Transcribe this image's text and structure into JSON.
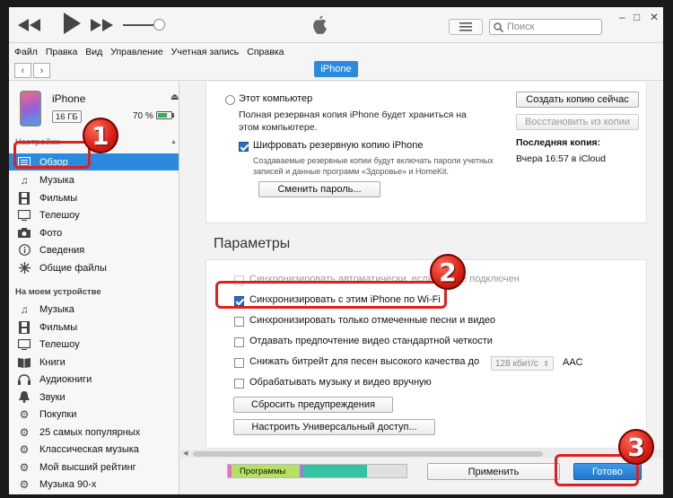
{
  "app": {
    "colors": {
      "accent": "#2a8bde",
      "callout": "#e02020",
      "battery": "#2fb34a"
    }
  },
  "player": {
    "icons": [
      "rewind-icon",
      "play-icon",
      "fast-forward-icon",
      "apple-logo-icon",
      "list-view-icon",
      "search-icon"
    ],
    "search_placeholder": "Поиск",
    "window_controls": [
      "–",
      "□",
      "✕"
    ]
  },
  "menu": [
    "Файл",
    "Правка",
    "Вид",
    "Управление",
    "Учетная запись",
    "Справка"
  ],
  "nav": {
    "device_tab": "iPhone"
  },
  "device": {
    "name": "iPhone",
    "capacity": "16 ГБ",
    "battery": "70 %",
    "battery_level": 0.7
  },
  "sidebar": {
    "settings_label": "Настройки",
    "settings_items": [
      {
        "label": "Обзор",
        "icon": "summary-icon"
      },
      {
        "label": "Музыка",
        "icon": "music-note-icon"
      },
      {
        "label": "Фильмы",
        "icon": "film-icon"
      },
      {
        "label": "Телешоу",
        "icon": "tv-icon"
      },
      {
        "label": "Фото",
        "icon": "camera-icon"
      },
      {
        "label": "Сведения",
        "icon": "info-icon"
      },
      {
        "label": "Общие файлы",
        "icon": "apps-icon"
      }
    ],
    "on_device_label": "На моем устройстве",
    "device_items": [
      {
        "label": "Музыка",
        "icon": "music-note-icon"
      },
      {
        "label": "Фильмы",
        "icon": "film-icon"
      },
      {
        "label": "Телешоу",
        "icon": "tv-icon"
      },
      {
        "label": "Книги",
        "icon": "book-icon"
      },
      {
        "label": "Аудиокниги",
        "icon": "audiobook-icon"
      },
      {
        "label": "Звуки",
        "icon": "bell-icon"
      },
      {
        "label": "Покупки",
        "icon": "purchases-icon"
      },
      {
        "label": "25 самых популярных",
        "icon": "gear-icon"
      },
      {
        "label": "Классическая музыка",
        "icon": "gear-icon"
      },
      {
        "label": "Мой высший рейтинг",
        "icon": "gear-icon"
      },
      {
        "label": "Музыка 90-х",
        "icon": "gear-icon"
      }
    ]
  },
  "backup": {
    "this_computer": "Этот компьютер",
    "this_computer_desc": "Полная резервная копия iPhone будет храниться на этом компьютере.",
    "encrypt_label": "Шифровать резервную копию iPhone",
    "encrypt_desc": "Создаваемые резервные копии будут включать пароли учетных записей и данные программ «Здоровье» и HomeKit.",
    "change_password": "Сменить пароль...",
    "backup_now": "Создать копию сейчас",
    "restore": "Восстановить из копии",
    "last_copy_label": "Последняя копия:",
    "last_copy_value": "Вчера 16:57 в iCloud"
  },
  "params": {
    "title": "Параметры",
    "auto_sync": "Синхронизировать автоматически, если iPhone подключен",
    "wifi_sync": "Синхронизировать с этим iPhone по Wi-Fi",
    "checked_only": "Синхронизировать только отмеченные песни и видео",
    "sd_video": "Отдавать предпочтение видео стандартной четкости",
    "bitrate_label": "Снижать битрейт для песен высокого качества до",
    "bitrate_value": "128 кбит/с",
    "bitrate_codec": "AAC",
    "manual": "Обрабатывать музыку и видео вручную",
    "reset_warnings": "Сбросить предупреждения",
    "accessibility": "Настроить Универсальный доступ..."
  },
  "bottom": {
    "storage_label": "Программы",
    "storage_segments": [
      {
        "color": "#e86bd6",
        "fraction": 0.02
      },
      {
        "color": "#b6e061",
        "fraction": 0.38
      },
      {
        "color": "#9b7fd8",
        "fraction": 0.02
      },
      {
        "color": "#34c4a4",
        "fraction": 0.36
      },
      {
        "color": "#e0e0e0",
        "fraction": 0.22
      }
    ],
    "apply": "Применить",
    "done": "Готово"
  },
  "callouts": [
    "1",
    "2",
    "3"
  ]
}
